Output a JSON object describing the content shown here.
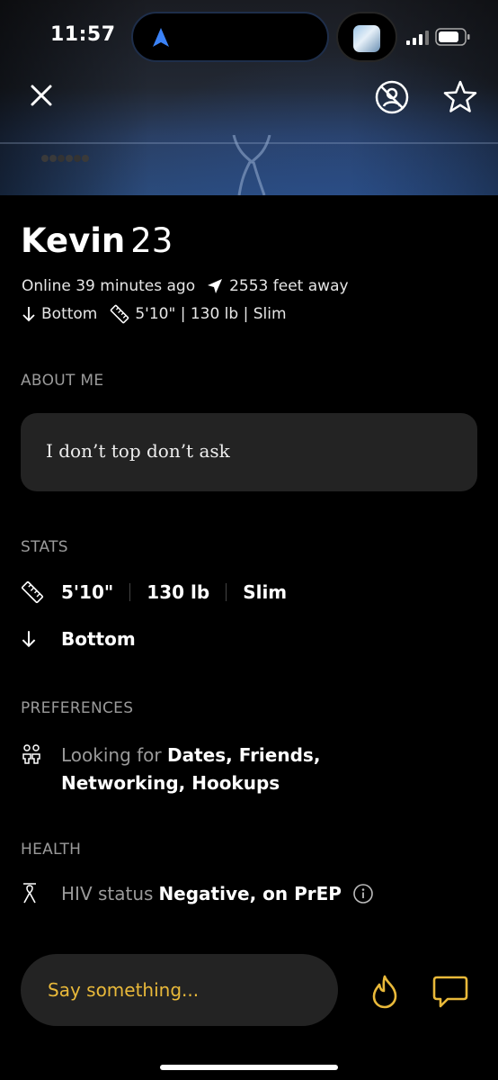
{
  "status_bar": {
    "time": "11:57"
  },
  "profile": {
    "name": "Kevin",
    "age": "23",
    "online": "Online 39 minutes ago",
    "distance": "2553 feet away",
    "position": "Bottom",
    "body_summary": "5'10\" | 130 lb | Slim"
  },
  "about": {
    "title": "ABOUT ME",
    "text": "I don’t top don’t ask"
  },
  "stats": {
    "title": "STATS",
    "height": "5'10\"",
    "weight": "130 lb",
    "body_type": "Slim",
    "position": "Bottom"
  },
  "preferences": {
    "title": "PREFERENCES",
    "label": "Looking for",
    "values": "Dates, Friends, Networking, Hookups"
  },
  "health": {
    "title": "HEALTH",
    "label": "HIV status",
    "value": "Negative, on PrEP"
  },
  "composer": {
    "placeholder": "Say something..."
  },
  "colors": {
    "accent": "#e9b93a",
    "background": "#000000",
    "card": "#232323"
  },
  "icons": [
    "close-icon",
    "block-icon",
    "star-icon",
    "location-arrow-icon",
    "arrow-down-icon",
    "ruler-icon",
    "people-icon",
    "ribbon-icon",
    "info-icon",
    "flame-icon",
    "chat-icon"
  ]
}
